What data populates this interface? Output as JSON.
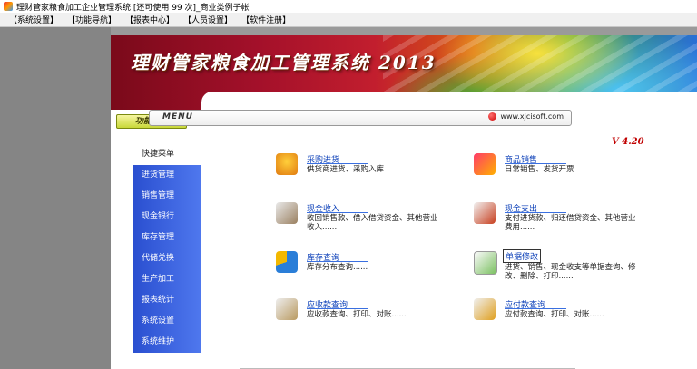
{
  "window": {
    "title": "理财管家粮食加工企业管理系统 [还可使用 99 次]_商业类例子帐"
  },
  "menubar": {
    "items": [
      "【系统设置】",
      "【功能导航】",
      "【报表中心】",
      "【人员设置】",
      "【软件注册】"
    ]
  },
  "banner": {
    "app_title": "理财管家粮食加工管理系统 2013"
  },
  "sidebar": {
    "header": "功能导航",
    "items": [
      "快捷菜单",
      "进货管理",
      "销售管理",
      "现金银行",
      "库存管理",
      "代储兑换",
      "生产加工",
      "报表统计",
      "系统设置",
      "系统维护"
    ]
  },
  "menu_box": {
    "label": "MENU",
    "website": "www.xjcisoft.com"
  },
  "version": "V 4.20",
  "modules": [
    {
      "title": "采购进货",
      "desc": "供货商进货、采购入库",
      "icon": "shopping-basket-icon"
    },
    {
      "title": "商品销售",
      "desc": "日常销售、发货开票",
      "icon": "shopping-bag-icon"
    },
    {
      "title": "现金收入",
      "desc": "收回销售款、借入借贷资金、其他营业收入......",
      "icon": "cash-register-icon"
    },
    {
      "title": "现金支出",
      "desc": "支付进货款、归还借贷资金、其他营业费用......",
      "icon": "cash-payout-icon"
    },
    {
      "title": "库存查询",
      "desc": "库存分布查询......",
      "icon": "pie-chart-icon"
    },
    {
      "title": "单据修改",
      "desc": "进货、销售、现金收支等单据查询、修改、删除、打印......",
      "icon": "document-edit-icon"
    },
    {
      "title": "应收款查询",
      "desc": "应收款查询、打印、对账......",
      "icon": "receivable-icon"
    },
    {
      "title": "应付款查询",
      "desc": "应付款查询、打印、对账......",
      "icon": "payable-icon"
    }
  ]
}
